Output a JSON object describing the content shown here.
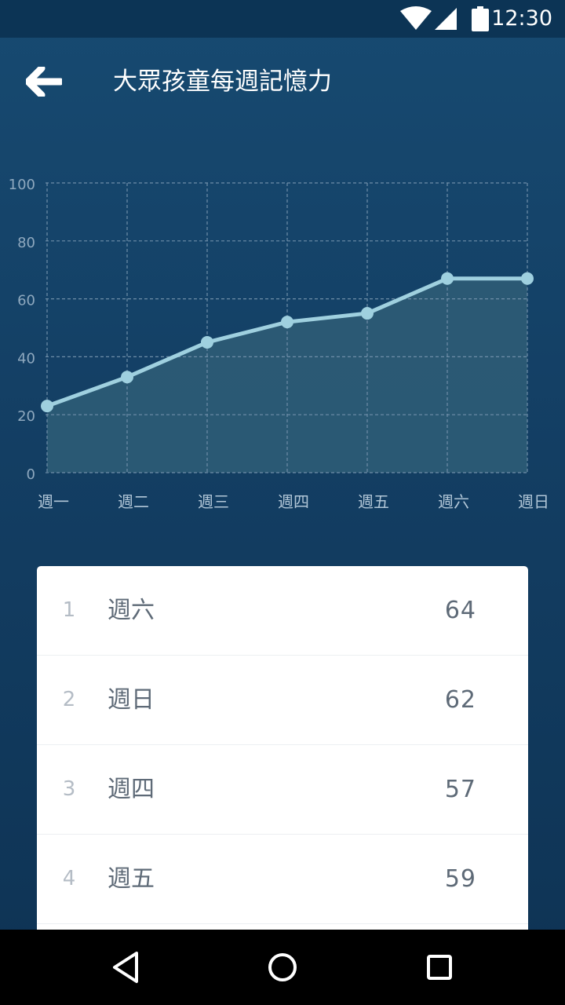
{
  "status_bar": {
    "time": "12:30",
    "icons": [
      "wifi-icon",
      "cell-signal-icon",
      "battery-icon"
    ]
  },
  "app_bar": {
    "title": "大眾孩童每週記憶力",
    "back_icon": "arrow-left-icon"
  },
  "chart_data": {
    "type": "area",
    "categories": [
      "週一",
      "週二",
      "週三",
      "週四",
      "週五",
      "週六",
      "週日"
    ],
    "values": [
      23,
      33,
      45,
      52,
      55,
      67,
      67
    ],
    "y_ticks": [
      "0",
      "20",
      "40",
      "60",
      "80",
      "100"
    ],
    "ylim": [
      0,
      100
    ],
    "grid": true,
    "colors": {
      "line": "#9fd0df",
      "fill": "#2e5c76",
      "grid": "#6f8ea8",
      "tick": "#8fa9bf",
      "category": "#b2c7d8"
    }
  },
  "ranking": [
    {
      "rank": "1",
      "label": "週六",
      "value": "64"
    },
    {
      "rank": "2",
      "label": "週日",
      "value": "62"
    },
    {
      "rank": "3",
      "label": "週四",
      "value": "57"
    },
    {
      "rank": "4",
      "label": "週五",
      "value": "59"
    }
  ],
  "nav_bar": {
    "icons": [
      "back-triangle-icon",
      "home-circle-icon",
      "recents-square-icon"
    ]
  }
}
